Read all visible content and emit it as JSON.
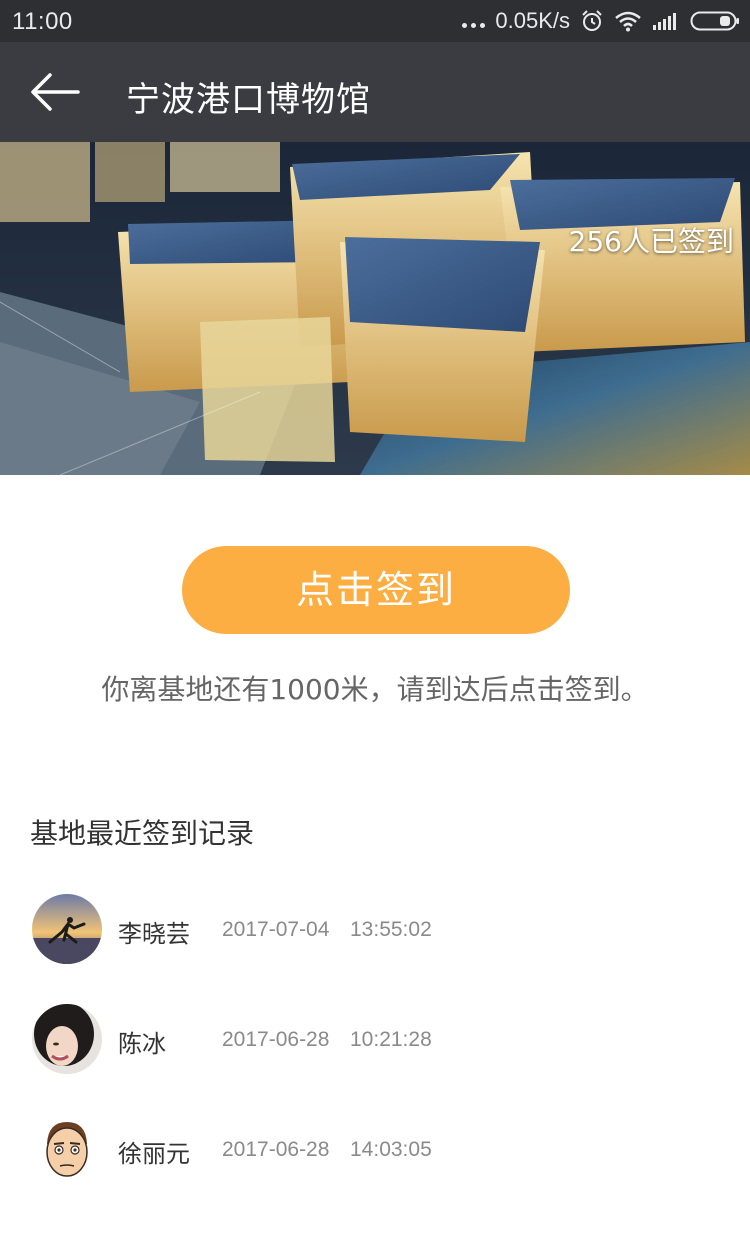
{
  "status_bar": {
    "time": "11:00",
    "net_speed": "0.05K/s",
    "icons": [
      "more-dots-icon",
      "alarm-icon",
      "wifi-icon",
      "signal-icon",
      "battery-icon"
    ]
  },
  "nav": {
    "back_icon": "back-arrow-icon",
    "title": "宁波港口博物馆"
  },
  "hero": {
    "image": "museum-night-photo",
    "checkin_count": "256人已签到"
  },
  "checkin": {
    "button_label": "点击签到",
    "note": "你离基地还有1000米，请到达后点击签到。"
  },
  "records": {
    "title": "基地最近签到记录",
    "items": [
      {
        "avatar": "avatar-sunset-jump",
        "name": "李晓芸",
        "date": "2017-07-04",
        "time": "13:55:02"
      },
      {
        "avatar": "avatar-girl-smile",
        "name": "陈冰",
        "date": "2017-06-28",
        "time": "10:21:28"
      },
      {
        "avatar": "avatar-cartoon-man",
        "name": "徐丽元",
        "date": "2017-06-28",
        "time": "14:03:05"
      }
    ]
  },
  "colors": {
    "status_bar_bg": "#2d2f33",
    "nav_bg": "#3a3c42",
    "accent": "#fdae42",
    "note_text": "#666666",
    "meta_text": "#8a8a8a"
  }
}
